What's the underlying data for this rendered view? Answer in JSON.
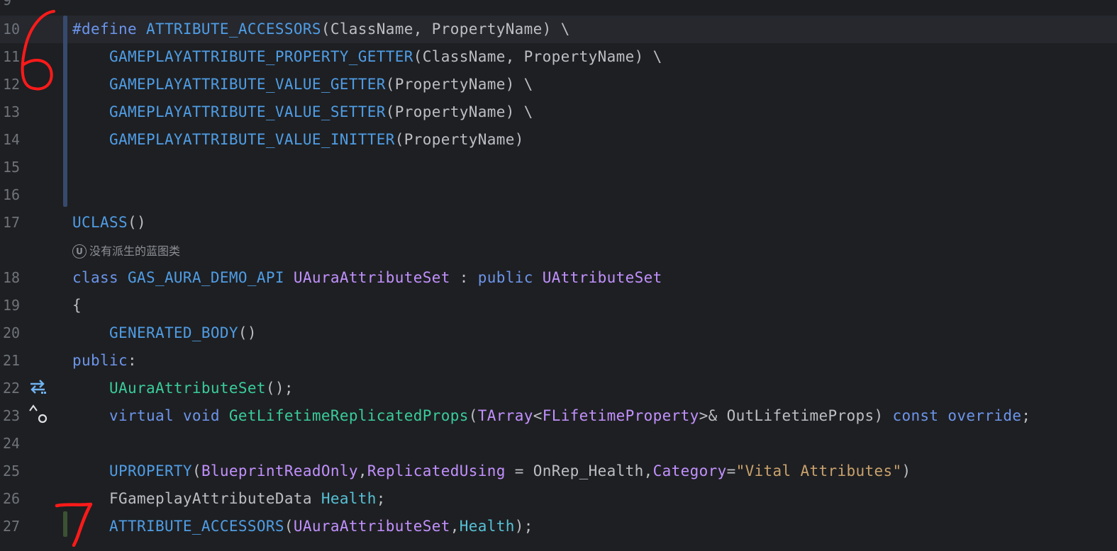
{
  "editor": {
    "top_partial_line": {
      "number": "9"
    },
    "lines": [
      {
        "number": "10",
        "current": true,
        "tokens": [
          {
            "t": "#define ",
            "c": "t-kw"
          },
          {
            "t": "ATTRIBUTE_ACCESSORS",
            "c": "t-macroc"
          },
          {
            "t": "(ClassName, PropertyName) \\",
            "c": "t-def"
          }
        ]
      },
      {
        "number": "11",
        "tokens": [
          {
            "t": "    ",
            "c": "t-def"
          },
          {
            "t": "GAMEPLAYATTRIBUTE_PROPERTY_GETTER",
            "c": "t-macroc"
          },
          {
            "t": "(ClassName, PropertyName) \\",
            "c": "t-def"
          }
        ]
      },
      {
        "number": "12",
        "tokens": [
          {
            "t": "    ",
            "c": "t-def"
          },
          {
            "t": "GAMEPLAYATTRIBUTE_VALUE_GETTER",
            "c": "t-macroc"
          },
          {
            "t": "(PropertyName) \\",
            "c": "t-def"
          }
        ]
      },
      {
        "number": "13",
        "tokens": [
          {
            "t": "    ",
            "c": "t-def"
          },
          {
            "t": "GAMEPLAYATTRIBUTE_VALUE_SETTER",
            "c": "t-macroc"
          },
          {
            "t": "(PropertyName) \\",
            "c": "t-def"
          }
        ]
      },
      {
        "number": "14",
        "tokens": [
          {
            "t": "    ",
            "c": "t-def"
          },
          {
            "t": "GAMEPLAYATTRIBUTE_VALUE_INITTER",
            "c": "t-macroc"
          },
          {
            "t": "(PropertyName)",
            "c": "t-def"
          }
        ]
      },
      {
        "number": "15",
        "tokens": []
      },
      {
        "number": "16",
        "tokens": []
      },
      {
        "number": "17",
        "tokens": [
          {
            "t": "UCLASS",
            "c": "t-macroc"
          },
          {
            "t": "()",
            "c": "t-def"
          }
        ]
      },
      {
        "number": "",
        "hint": "没有派生的蓝图类",
        "hint_badge": "U"
      },
      {
        "number": "18",
        "tokens": [
          {
            "t": "class ",
            "c": "t-kw"
          },
          {
            "t": "GAS_AURA_DEMO_API ",
            "c": "t-macroc"
          },
          {
            "t": "UAuraAttributeSet",
            "c": "t-type"
          },
          {
            "t": " : ",
            "c": "t-def"
          },
          {
            "t": "public ",
            "c": "t-kw"
          },
          {
            "t": "UAttributeSet",
            "c": "t-type"
          }
        ]
      },
      {
        "number": "19",
        "tokens": [
          {
            "t": "{",
            "c": "t-def"
          }
        ]
      },
      {
        "number": "20",
        "tokens": [
          {
            "t": "    ",
            "c": "t-def"
          },
          {
            "t": "GENERATED_BODY",
            "c": "t-macroc"
          },
          {
            "t": "()",
            "c": "t-def"
          }
        ]
      },
      {
        "number": "21",
        "tokens": [
          {
            "t": "public",
            "c": "t-kw"
          },
          {
            "t": ":",
            "c": "t-def"
          }
        ]
      },
      {
        "number": "22",
        "gutter_icon": "implementation-toggle-icon",
        "tokens": [
          {
            "t": "    ",
            "c": "t-def"
          },
          {
            "t": "UAuraAttributeSet",
            "c": "t-fn"
          },
          {
            "t": "();",
            "c": "t-def"
          }
        ]
      },
      {
        "number": "23",
        "gutter_icon": "overrides-method-icon",
        "tokens": [
          {
            "t": "    ",
            "c": "t-def"
          },
          {
            "t": "virtual ",
            "c": "t-kw"
          },
          {
            "t": "void ",
            "c": "t-kw"
          },
          {
            "t": "GetLifetimeReplicatedProps",
            "c": "t-fn"
          },
          {
            "t": "(",
            "c": "t-def"
          },
          {
            "t": "TArray",
            "c": "t-type"
          },
          {
            "t": "<",
            "c": "t-def"
          },
          {
            "t": "FLifetimeProperty",
            "c": "t-type"
          },
          {
            "t": ">& OutLifetimeProps) ",
            "c": "t-def"
          },
          {
            "t": "const ",
            "c": "t-kw"
          },
          {
            "t": "override",
            "c": "t-kw"
          },
          {
            "t": ";",
            "c": "t-def"
          }
        ]
      },
      {
        "number": "24",
        "tokens": []
      },
      {
        "number": "25",
        "tokens": [
          {
            "t": "    ",
            "c": "t-def"
          },
          {
            "t": "UPROPERTY",
            "c": "t-macroc"
          },
          {
            "t": "(",
            "c": "t-def"
          },
          {
            "t": "BlueprintReadOnly",
            "c": "t-type"
          },
          {
            "t": ",",
            "c": "t-def"
          },
          {
            "t": "ReplicatedUsing",
            "c": "t-type"
          },
          {
            "t": " = OnRep_Health,",
            "c": "t-def"
          },
          {
            "t": "Category",
            "c": "t-type"
          },
          {
            "t": "=",
            "c": "t-def"
          },
          {
            "t": "\"Vital Attributes\"",
            "c": "t-str"
          },
          {
            "t": ")",
            "c": "t-def"
          }
        ]
      },
      {
        "number": "26",
        "tokens": [
          {
            "t": "    ",
            "c": "t-def"
          },
          {
            "t": "FGameplayAttributeData ",
            "c": "t-def"
          },
          {
            "t": "Health",
            "c": "t-var"
          },
          {
            "t": ";",
            "c": "t-def"
          }
        ]
      },
      {
        "number": "27",
        "tokens": [
          {
            "t": "    ",
            "c": "t-def"
          },
          {
            "t": "ATTRIBUTE_ACCESSORS",
            "c": "t-macroc"
          },
          {
            "t": "(",
            "c": "t-def"
          },
          {
            "t": "UAuraAttributeSet",
            "c": "t-type"
          },
          {
            "t": ",",
            "c": "t-def"
          },
          {
            "t": "Health",
            "c": "t-var"
          },
          {
            "t": ");",
            "c": "t-def"
          }
        ]
      }
    ]
  },
  "annotations": {
    "handwritten_6": "6",
    "handwritten_7": "7",
    "ink_color": "#ff1a1a"
  },
  "colors": {
    "background": "#1e1f22",
    "current_line": "#26282e",
    "modified_bar": "#374a6e",
    "added_bar": "#3b5233"
  }
}
